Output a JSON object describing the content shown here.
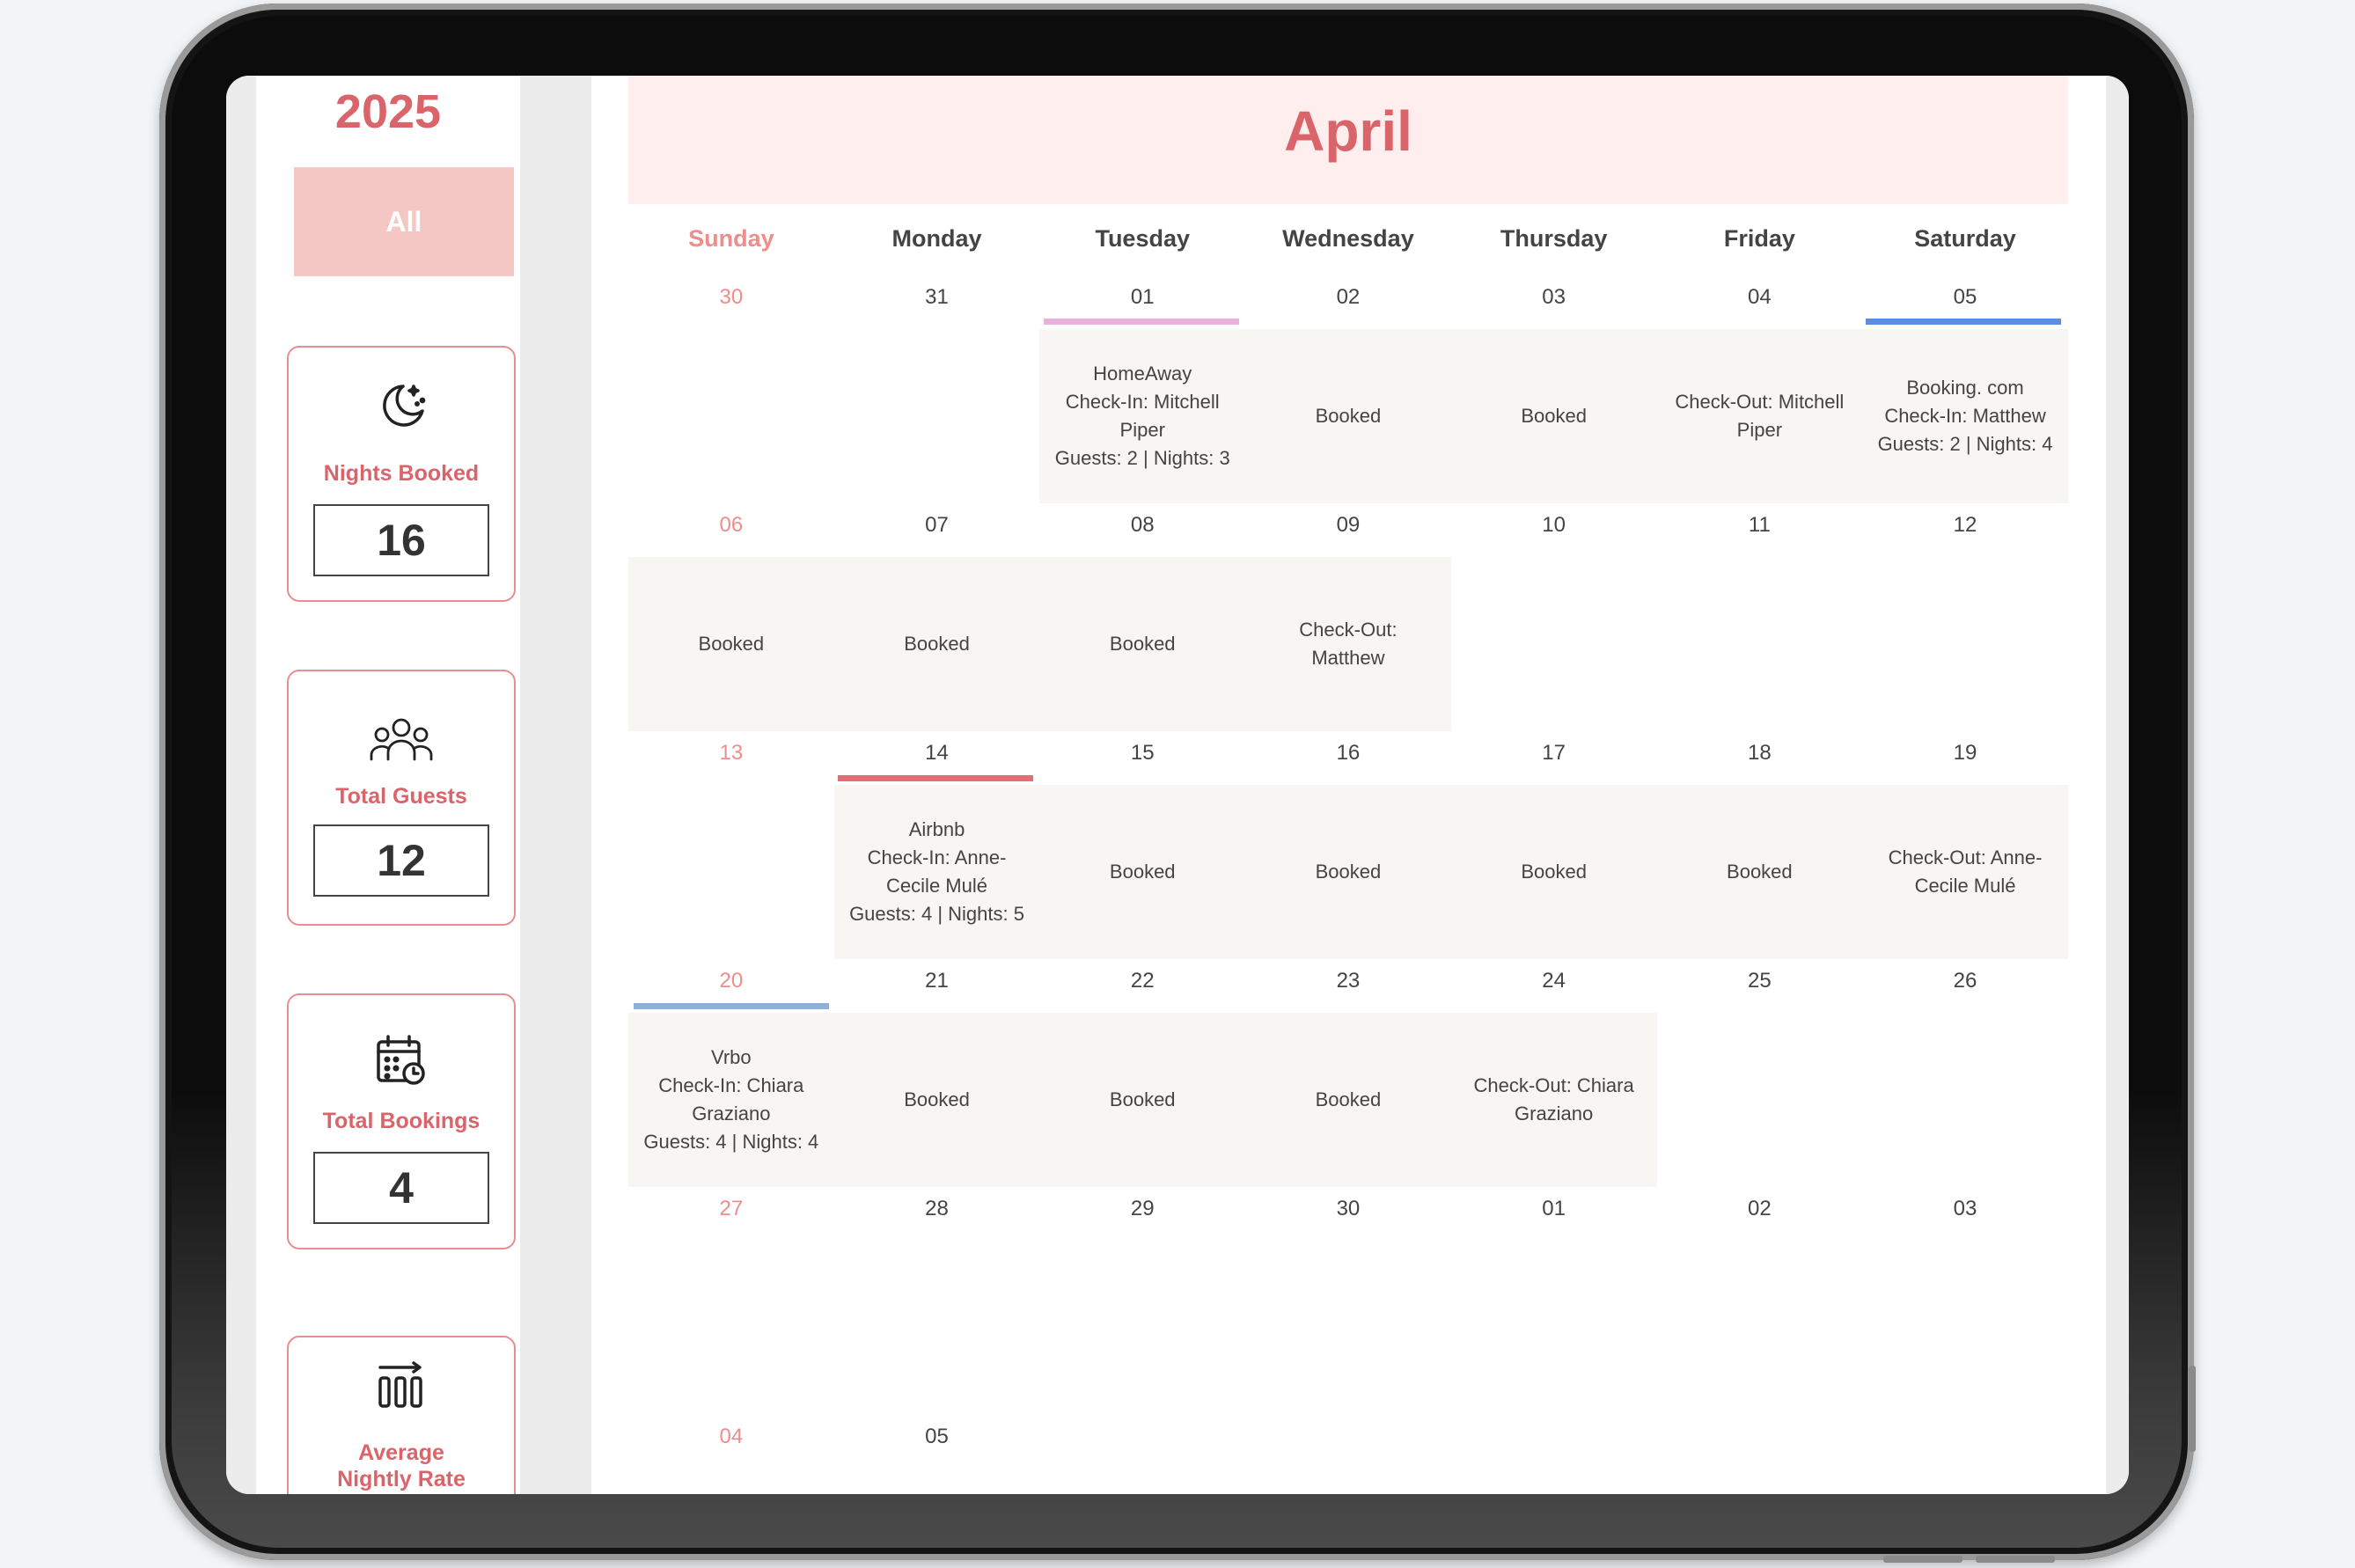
{
  "sidebar": {
    "year": "2025",
    "filter_label": "All",
    "stats": [
      {
        "label": "Nights Booked",
        "value": "16",
        "icon": "moon-stars-icon"
      },
      {
        "label": "Total Guests",
        "value": "12",
        "icon": "guests-icon"
      },
      {
        "label": "Total Bookings",
        "value": "4",
        "icon": "calendar-clock-icon"
      },
      {
        "label": "Average Nightly Rate",
        "icon": "bar-chart-icon"
      }
    ]
  },
  "calendar": {
    "month": "April",
    "weekdays": [
      "Sunday",
      "Monday",
      "Tuesday",
      "Wednesday",
      "Thursday",
      "Friday",
      "Saturday"
    ],
    "weeks": [
      [
        "30",
        "31",
        "01",
        "02",
        "03",
        "04",
        "05"
      ],
      [
        "06",
        "07",
        "08",
        "09",
        "10",
        "11",
        "12"
      ],
      [
        "13",
        "14",
        "15",
        "16",
        "17",
        "18",
        "19"
      ],
      [
        "20",
        "21",
        "22",
        "23",
        "24",
        "25",
        "26"
      ],
      [
        "27",
        "28",
        "29",
        "30",
        "01",
        "02",
        "03"
      ],
      [
        "04",
        "05"
      ]
    ],
    "events": {
      "w0": [
        "",
        "",
        "HomeAway\nCheck-In: Mitchell\nPiper\nGuests: 2 | Nights: 3",
        "Booked",
        "Booked",
        "Check-Out: Mitchell\nPiper",
        "Booking. com\nCheck-In: Matthew\nGuests: 2 | Nights: 4"
      ],
      "w1": [
        "Booked",
        "Booked",
        "Booked",
        "Check-Out:\nMatthew",
        "",
        "",
        ""
      ],
      "w2": [
        "",
        "Airbnb\nCheck-In: Anne-\nCecile Mulé\nGuests: 4 | Nights: 5",
        "Booked",
        "Booked",
        "Booked",
        "Booked",
        "Check-Out: Anne-\nCecile Mulé"
      ],
      "w3": [
        "Vrbo\nCheck-In: Chiara\nGraziano\nGuests: 4 | Nights: 4",
        "Booked",
        "Booked",
        "Booked",
        "Check-Out: Chiara\nGraziano",
        "",
        ""
      ]
    }
  },
  "colors": {
    "accent": "#d9646a",
    "homeaway": "#e9b1dc",
    "booking": "#5a8ee3",
    "airbnb": "#e06f73",
    "vrbo": "#8fb0dc"
  }
}
